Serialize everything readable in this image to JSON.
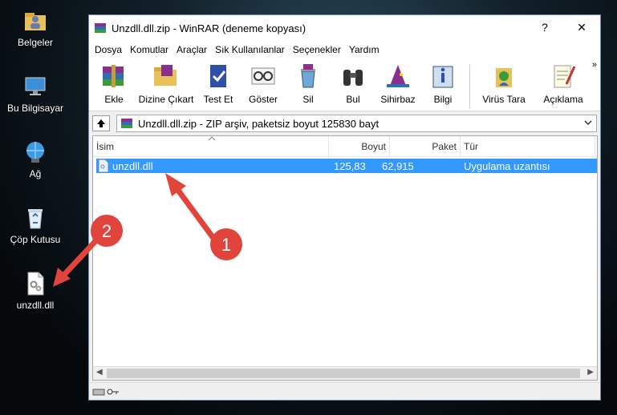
{
  "desktop": {
    "icons": [
      {
        "label": "Belgeler",
        "icon": "folder-user-icon"
      },
      {
        "label": "Bu Bilgisayar",
        "icon": "computer-icon"
      },
      {
        "label": "Ağ",
        "icon": "network-icon"
      },
      {
        "label": "Çöp Kutusu",
        "icon": "recycle-bin-icon"
      },
      {
        "label": "unzdll.dll",
        "icon": "dll-file-icon"
      }
    ]
  },
  "window": {
    "title": "Unzdll.dll.zip - WinRAR (deneme kopyası)",
    "help_btn": "?",
    "close_btn": "✕"
  },
  "menu": [
    "Dosya",
    "Komutlar",
    "Araçlar",
    "Sık Kullanılanlar",
    "Seçenekler",
    "Yardım"
  ],
  "toolbar": [
    "Ekle",
    "Dizine Çıkart",
    "Test Et",
    "Göster",
    "Sil",
    "Bul",
    "Sihirbaz",
    "Bilgi",
    "Virüs Tara",
    "Açıklama"
  ],
  "toolbar_more": "»",
  "address": {
    "text": "Unzdll.dll.zip - ZIP arşiv, paketsiz boyut 125830 bayt"
  },
  "columns": [
    "İsim",
    "Boyut",
    "Paket",
    "Tür"
  ],
  "rows": [
    {
      "name": "unzdll.dll",
      "size": "125,83",
      "packed": "62,915",
      "type": "Uygulama uzantısı"
    }
  ],
  "annotations": {
    "one": "1",
    "two": "2"
  },
  "colors": {
    "selection": "#3399ff",
    "arrow": "#e0443a"
  }
}
